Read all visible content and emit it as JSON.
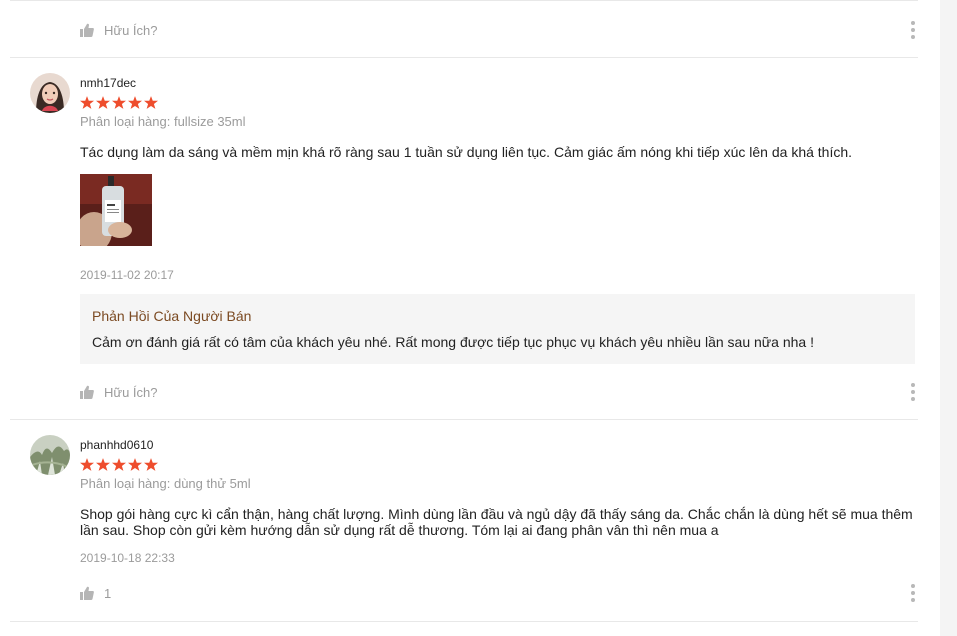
{
  "reviews_top": {
    "helpful_label": "Hữu Ích?"
  },
  "review1": {
    "username": "nmh17dec",
    "rating": 5,
    "variation": "Phân loại hàng: fullsize 35ml",
    "content": "Tác dụng làm da sáng và mềm mịn khá rõ ràng sau 1 tuần sử dụng liên tục. Cảm giác ấm nóng khi tiếp xúc lên da khá thích.",
    "timestamp": "2019-11-02 20:17",
    "seller_reply": {
      "title": "Phản Hồi Của Người Bán",
      "text": "Cảm ơn đánh giá rất có tâm của khách yêu nhé. Rất mong được tiếp tục phục vụ khách yêu nhiều lần sau nữa nha !"
    },
    "helpful_label": "Hữu Ích?"
  },
  "review2": {
    "username": "phanhhd0610",
    "rating": 5,
    "variation": "Phân loại hàng: dùng thử 5ml",
    "content": "Shop gói hàng cực kì cẩn thận, hàng chất lượng. Mình dùng lần đầu và ngủ dậy đã thấy sáng da. Chắc chắn là dùng hết sẽ mua thêm lần sau. Shop còn gửi kèm hướng dẫn sử dụng rất dễ thương. Tóm lại ai đang phân vân thì nên mua a",
    "timestamp": "2019-10-18 22:33",
    "helpful_count": "1"
  },
  "colors": {
    "star": "#ee4d2d",
    "reply_title": "#7b4a22",
    "muted_text": "#9b9b9b"
  },
  "icons": {
    "thumb": "thumbs-up-icon",
    "more": "more-vertical-icon",
    "star": "star-icon"
  }
}
